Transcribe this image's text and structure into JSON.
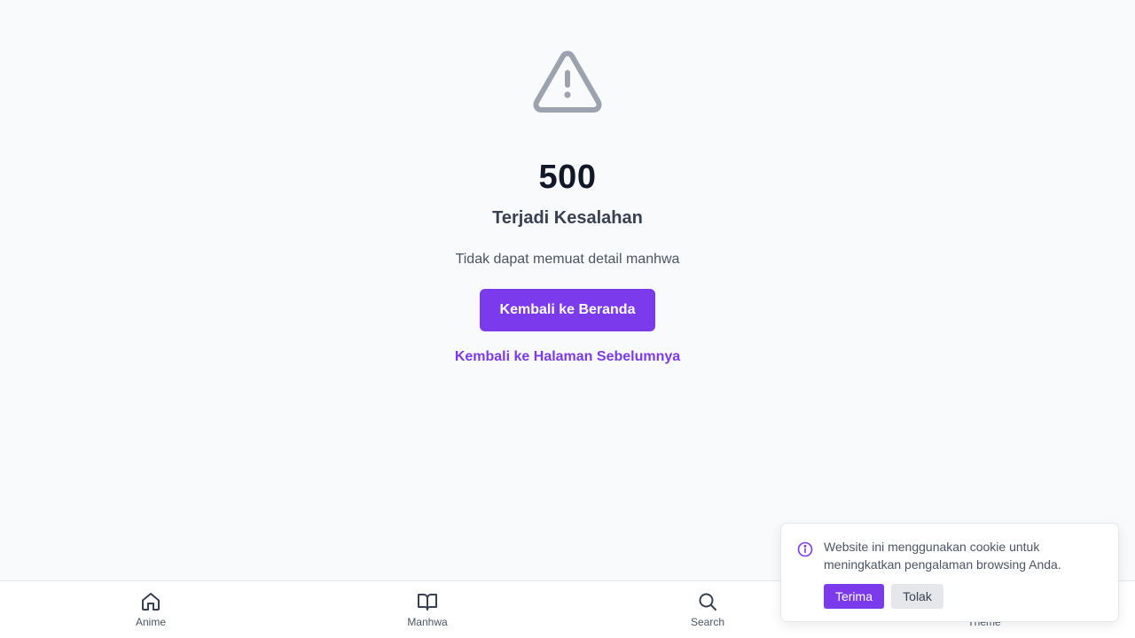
{
  "error": {
    "icon": "warning-triangle-icon",
    "code": "500",
    "title": "Terjadi Kesalahan",
    "message": "Tidak dapat memuat detail manhwa",
    "home_button_label": "Kembali ke Beranda",
    "back_link_label": "Kembali ke Halaman Sebelumnya"
  },
  "bottom_nav": {
    "items": [
      {
        "label": "Anime",
        "icon": "home-icon"
      },
      {
        "label": "Manhwa",
        "icon": "book-open-icon"
      },
      {
        "label": "Search",
        "icon": "search-icon"
      },
      {
        "label": "Theme",
        "icon": "theme-icon"
      }
    ]
  },
  "cookie_banner": {
    "icon": "info-icon",
    "message": "Website ini menggunakan cookie untuk meningkatkan pengalaman browsing Anda.",
    "accept_label": "Terima",
    "reject_label": "Tolak"
  },
  "colors": {
    "accent": "#7c3aed",
    "background": "#f9fafb",
    "icon_gray": "#9ca3af"
  }
}
